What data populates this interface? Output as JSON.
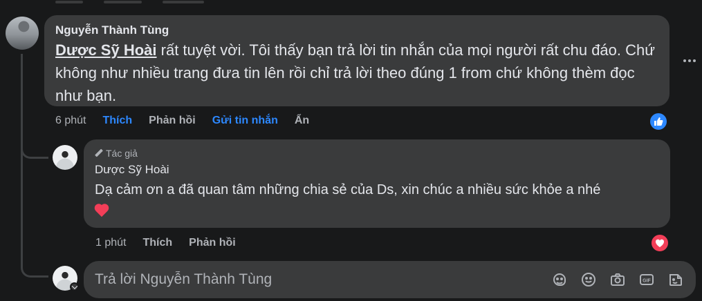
{
  "comment": {
    "author_name": "Nguyễn Thành Tùng",
    "mention": "Dược Sỹ Hoài",
    "text": " rất tuyệt vời. Tôi thấy bạn trả lời tin nhắn của mọi người rất chu đáo. Chứ không như nhiều trang đưa tin lên rồi chỉ trả lời theo đúng 1 from chứ không thèm đọc như bạn.",
    "time": "6 phút",
    "actions": {
      "like": "Thích",
      "reply": "Phản hồi",
      "send_message": "Gửi tin nhắn",
      "hide": "Ẩn"
    },
    "reaction_icon": "like-icon",
    "colors": {
      "link": "#2d88ff",
      "like": "#2d88ff"
    }
  },
  "reply": {
    "badge": "Tác giả",
    "author_name": "Dược Sỹ Hoài",
    "text": "Dạ cảm ơn a đã quan tâm những chia sẻ của Ds, xin chúc a nhiều sức khỏe a nhé",
    "emoji": "heart-emoji",
    "time": "1 phút",
    "actions": {
      "like": "Thích",
      "reply": "Phản hồi"
    },
    "reaction_icon": "love-icon",
    "colors": {
      "love": "#f33e58"
    }
  },
  "reply_box": {
    "placeholder": "Trả lời Nguyễn Thành Tùng",
    "tools": [
      "sticker-icon",
      "emoji-icon",
      "camera-icon",
      "gif-icon",
      "sticker-face-icon"
    ]
  },
  "theme": {
    "background": "#18191a",
    "bubble": "#3a3b3c",
    "text": "#e4e6eb",
    "muted": "#b0b3b8"
  }
}
